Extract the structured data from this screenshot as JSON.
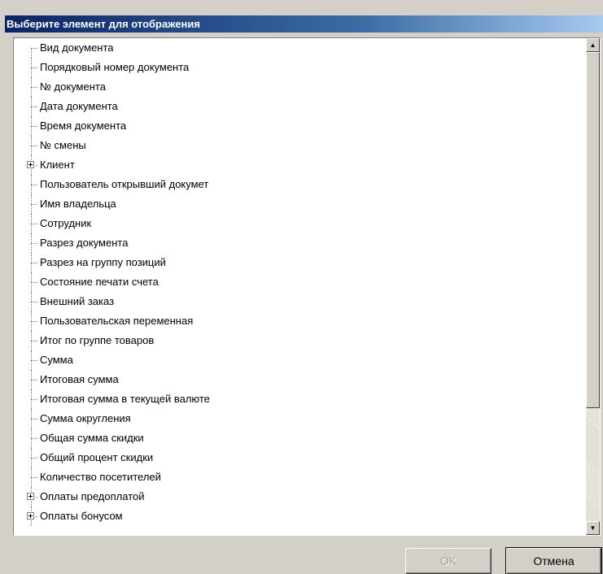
{
  "dialog": {
    "title": "Выберите элемент для отображения"
  },
  "tree": {
    "items": [
      {
        "label": "Вид документа",
        "expandable": false
      },
      {
        "label": "Порядковый номер документа",
        "expandable": false
      },
      {
        "label": "№ документа",
        "expandable": false
      },
      {
        "label": "Дата документа",
        "expandable": false
      },
      {
        "label": "Время документа",
        "expandable": false
      },
      {
        "label": "№ смены",
        "expandable": false
      },
      {
        "label": "Клиент",
        "expandable": true
      },
      {
        "label": "Пользователь открывший докумет",
        "expandable": false
      },
      {
        "label": "Имя владельца",
        "expandable": false
      },
      {
        "label": "Сотрудник",
        "expandable": false
      },
      {
        "label": "Разрез документа",
        "expandable": false
      },
      {
        "label": "Разрез на группу позиций",
        "expandable": false
      },
      {
        "label": "Состояние печати счета",
        "expandable": false
      },
      {
        "label": "Внешний заказ",
        "expandable": false
      },
      {
        "label": "Пользовательская переменная",
        "expandable": false
      },
      {
        "label": "Итог по группе товаров",
        "expandable": false
      },
      {
        "label": "Сумма",
        "expandable": false
      },
      {
        "label": "Итоговая сумма",
        "expandable": false
      },
      {
        "label": "Итоговая сумма в текущей валюте",
        "expandable": false
      },
      {
        "label": "Сумма округления",
        "expandable": false
      },
      {
        "label": "Общая сумма скидки",
        "expandable": false
      },
      {
        "label": "Общий процент скидки",
        "expandable": false
      },
      {
        "label": "Количество посетителей",
        "expandable": false
      },
      {
        "label": "Оплаты предоплатой",
        "expandable": true
      },
      {
        "label": "Оплаты бонусом",
        "expandable": true
      }
    ]
  },
  "scrollbar": {
    "up_icon": "arrow-up-icon",
    "down_icon": "arrow-down-icon",
    "up_glyph": "▲",
    "down_glyph": "▼"
  },
  "buttons": {
    "ok_label": "OK",
    "cancel_label": "Отмена"
  },
  "colors": {
    "title_gradient_start": "#0a246a",
    "title_gradient_end": "#a6caf0",
    "face": "#d4d0c8"
  }
}
